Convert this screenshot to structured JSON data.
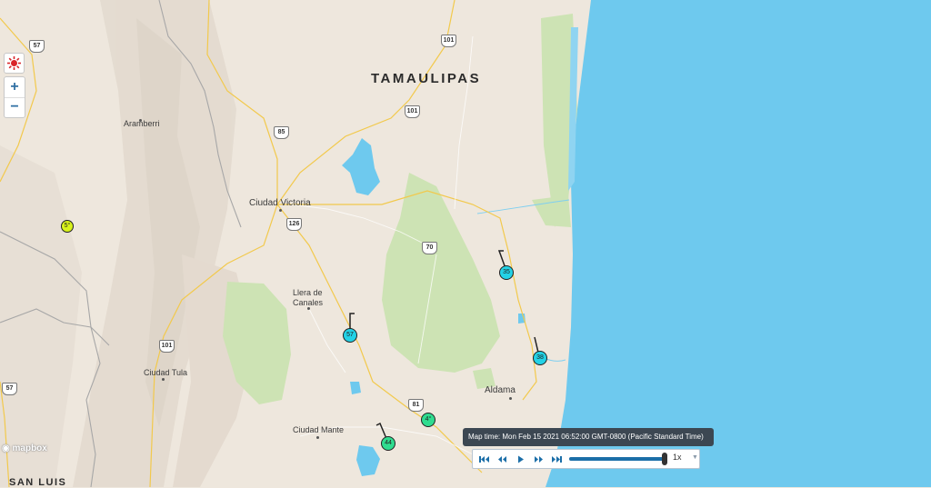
{
  "map": {
    "state_labels": [
      "TAMAULIPAS",
      "SAN LUIS"
    ],
    "cities": [
      "Ciudad Victoria",
      "Aramberri",
      "Llera de\nCanales",
      "Ciudad Tula",
      "Ciudad Mante",
      "Aldama"
    ],
    "highways": [
      "57",
      "101",
      "101",
      "85",
      "126",
      "70",
      "101",
      "81",
      "57"
    ],
    "logo": "mapbox"
  },
  "stations": [
    "5°",
    "35",
    "57",
    "38",
    "4°",
    "44"
  ],
  "colors": {
    "water": "#6ec9ee",
    "land": "#eee7dd",
    "parks": "#cde3b4",
    "roads": "#f2c94c",
    "station_cyan": "#23d2e6",
    "station_green": "#2fdc8f",
    "station_yellow": "#d8f21b"
  },
  "controls": {
    "icons": [
      "first-icon",
      "rewind-icon",
      "play-icon",
      "fast-forward-icon",
      "last-icon"
    ],
    "speed": "1x",
    "progress": 0.97,
    "zoom_in": "+",
    "zoom_out": "−"
  },
  "tooltip": "Map time: Mon Feb 15 2021 06:52:00 GMT-0800 (Pacific Standard Time)"
}
